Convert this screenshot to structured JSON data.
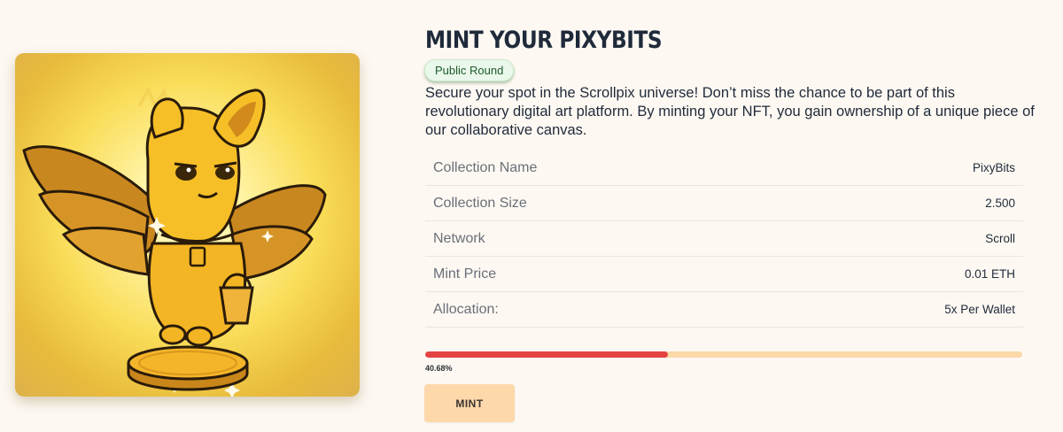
{
  "art": {
    "name": "pixybit-artwork"
  },
  "header": {
    "title": "MINT YOUR PIXYBITS",
    "round_badge": "Public Round"
  },
  "description": "Secure your spot in the Scrollpix universe! Don’t miss the chance to be part of this revolutionary digital art platform. By minting your NFT, you gain ownership of a unique piece of our collaborative canvas.",
  "details": [
    {
      "label": "Collection Name",
      "value": "PixyBits"
    },
    {
      "label": "Collection Size",
      "value": "2.500"
    },
    {
      "label": "Network",
      "value": "Scroll"
    },
    {
      "label": "Mint Price",
      "value": "0.01 ETH"
    },
    {
      "label": "Allocation:",
      "value": "5x Per Wallet"
    }
  ],
  "progress": {
    "percent": 40.68,
    "label": "40.68%"
  },
  "mint_button": {
    "label": "MINT"
  },
  "colors": {
    "page_bg": "#fdf8f2",
    "progress_fill": "#e44343",
    "progress_track": "#fbd9a8",
    "mint_button_bg": "#fdd8ab",
    "badge_text": "#1e5a2d"
  }
}
